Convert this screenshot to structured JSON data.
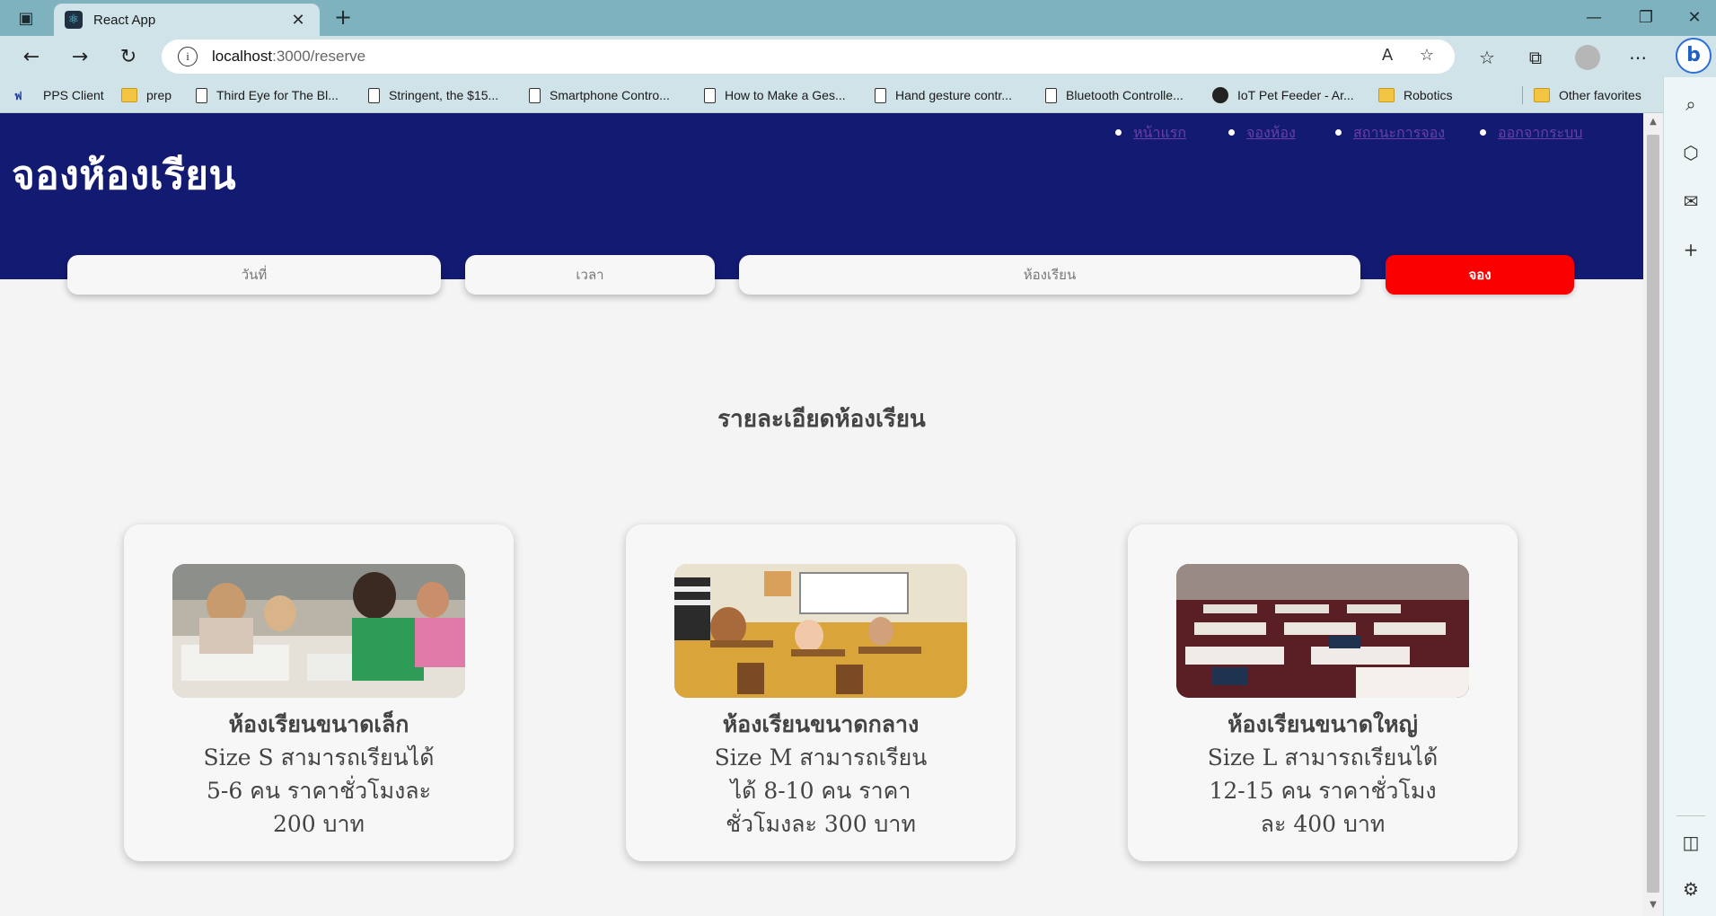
{
  "browser": {
    "tab_title": "React App",
    "url_host": "localhost",
    "url_path": ":3000/reserve",
    "bookmarks": [
      {
        "label": "PPS Client",
        "icon": "pps-icon"
      },
      {
        "label": "prep",
        "icon": "folder-icon"
      },
      {
        "label": "Third Eye for The Bl...",
        "icon": "page-icon"
      },
      {
        "label": "Stringent, the $15...",
        "icon": "page-icon"
      },
      {
        "label": "Smartphone Contro...",
        "icon": "page-icon"
      },
      {
        "label": "How to Make a Ges...",
        "icon": "page-icon"
      },
      {
        "label": "Hand gesture contr...",
        "icon": "page-icon"
      },
      {
        "label": "Bluetooth Controlle...",
        "icon": "page-icon"
      },
      {
        "label": "IoT Pet Feeder - Ar...",
        "icon": "instructables-icon"
      },
      {
        "label": "Robotics",
        "icon": "folder-icon"
      },
      {
        "label": "Other favorites",
        "icon": "folder-icon"
      }
    ]
  },
  "page": {
    "title": "จองห้องเรียน",
    "nav": [
      {
        "label": "หน้าแรก"
      },
      {
        "label": "จองห้อง"
      },
      {
        "label": "สถานะการจอง"
      },
      {
        "label": "ออกจากระบบ"
      }
    ],
    "form": {
      "date_label": "วันที่",
      "time_label": "เวลา",
      "room_label": "ห้องเรียน",
      "reserve_label": "จอง"
    },
    "section_heading": "รายละเอียดห้องเรียน",
    "rooms": [
      {
        "name": "ห้องเรียนขนาดเล็ก",
        "description_lines": [
          "Size S สามารถเรียนได้",
          "5-6 คน ราคาชั่วโมงละ",
          "200 บาท"
        ]
      },
      {
        "name": "ห้องเรียนขนาดกลาง",
        "description_lines": [
          "Size M สามารถเรียน",
          "ได้ 8-10 คน ราคา",
          "ชั่วโมงละ 300 บาท"
        ]
      },
      {
        "name": "ห้องเรียนขนาดใหญ่",
        "description_lines": [
          "Size L สามารถเรียนได้",
          "12-15 คน ราคาชั่วโมง",
          "ละ 400 บาท"
        ]
      }
    ]
  },
  "colors": {
    "header_bg": "#131a72",
    "reserve_button": "#fb0000",
    "page_bg": "#f4f4f4",
    "tabbar": "#7fb2bf"
  }
}
